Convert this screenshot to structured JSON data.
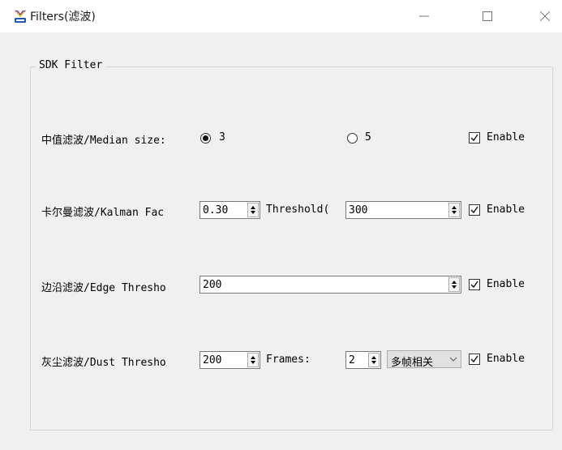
{
  "window": {
    "title": "Filters(滤波)",
    "controls": [
      "minimize-icon",
      "maximize-icon",
      "close-icon"
    ]
  },
  "group": {
    "title": "SDK Filter"
  },
  "median": {
    "label": "中值滤波/Median size:",
    "options": [
      {
        "label": "3",
        "checked": true
      },
      {
        "label": "5",
        "checked": false
      }
    ],
    "enable_label": "Enable",
    "enabled": true
  },
  "kalman": {
    "label": "卡尔曼滤波/Kalman Fac",
    "factor": "0.30",
    "threshold_label": "Threshold(",
    "threshold": "300",
    "enable_label": "Enable",
    "enabled": true
  },
  "edge": {
    "label": "边沿滤波/Edge Thresho",
    "threshold": "200",
    "enable_label": "Enable",
    "enabled": true
  },
  "dust": {
    "label": "灰尘滤波/Dust Thresho",
    "threshold": "200",
    "frames_label": "Frames:",
    "frames": "2",
    "mode": "多帧相关",
    "enable_label": "Enable",
    "enabled": true
  }
}
